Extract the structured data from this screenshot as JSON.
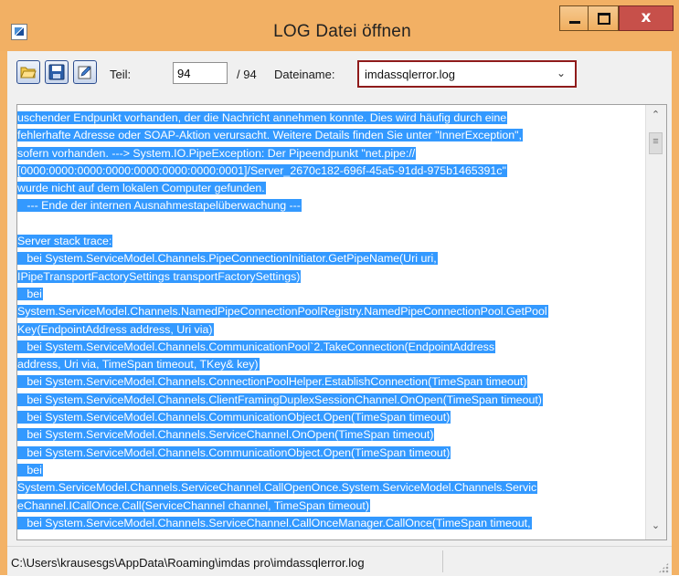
{
  "window": {
    "title": "LOG Datei öffnen",
    "close_label": "x"
  },
  "toolbar": {
    "open_icon": "folder-open-icon",
    "save_icon": "floppy-save-icon",
    "edit_icon": "edit-icon",
    "teil_label": "Teil:",
    "teil_value": "94",
    "total_label": "/ 94",
    "dateiname_label": "Dateiname:",
    "dateiname_value": "imdassqlerror.log"
  },
  "log": {
    "lines": [
      "uschender Endpunkt vorhanden, der die Nachricht annehmen konnte. Dies wird häufig durch eine",
      "fehlerhafte Adresse oder SOAP-Aktion verursacht. Weitere Details finden Sie unter \"InnerException\",",
      "sofern vorhanden. ---> System.IO.PipeException: Der Pipeendpunkt \"net.pipe://",
      "[0000:0000:0000:0000:0000:0000:0000:0001]/Server_2670c182-696f-45a5-91dd-975b1465391c\"",
      "wurde nicht auf dem lokalen Computer gefunden.",
      "   --- Ende der internen Ausnahmestapelüberwachung ---",
      "",
      "Server stack trace:",
      "   bei System.ServiceModel.Channels.PipeConnectionInitiator.GetPipeName(Uri uri,",
      "IPipeTransportFactorySettings transportFactorySettings)",
      "   bei",
      "System.ServiceModel.Channels.NamedPipeConnectionPoolRegistry.NamedPipeConnectionPool.GetPool",
      "Key(EndpointAddress address, Uri via)",
      "   bei System.ServiceModel.Channels.CommunicationPool`2.TakeConnection(EndpointAddress",
      "address, Uri via, TimeSpan timeout, TKey& key)",
      "   bei System.ServiceModel.Channels.ConnectionPoolHelper.EstablishConnection(TimeSpan timeout)",
      "   bei System.ServiceModel.Channels.ClientFramingDuplexSessionChannel.OnOpen(TimeSpan timeout)",
      "   bei System.ServiceModel.Channels.CommunicationObject.Open(TimeSpan timeout)",
      "   bei System.ServiceModel.Channels.ServiceChannel.OnOpen(TimeSpan timeout)",
      "   bei System.ServiceModel.Channels.CommunicationObject.Open(TimeSpan timeout)",
      "   bei",
      "System.ServiceModel.Channels.ServiceChannel.CallOpenOnce.System.ServiceModel.Channels.Servic",
      "eChannel.ICallOnce.Call(ServiceChannel channel, TimeSpan timeout)",
      "   bei System.ServiceModel.Channels.ServiceChannel.CallOnceManager.CallOnce(TimeSpan timeout,"
    ]
  },
  "scrollbar": {
    "up_icon": "scroll-up-arrow-icon",
    "down_icon": "scroll-down-arrow-icon"
  },
  "status": {
    "path": "C:\\Users\\krausesgs\\AppData\\Roaming\\imdas pro\\imdassqlerror.log"
  },
  "colors": {
    "titlebar": "#f2b064",
    "selection": "#3399ff",
    "close_button": "#c7504a",
    "dropdown_border": "#8f1b1b"
  }
}
